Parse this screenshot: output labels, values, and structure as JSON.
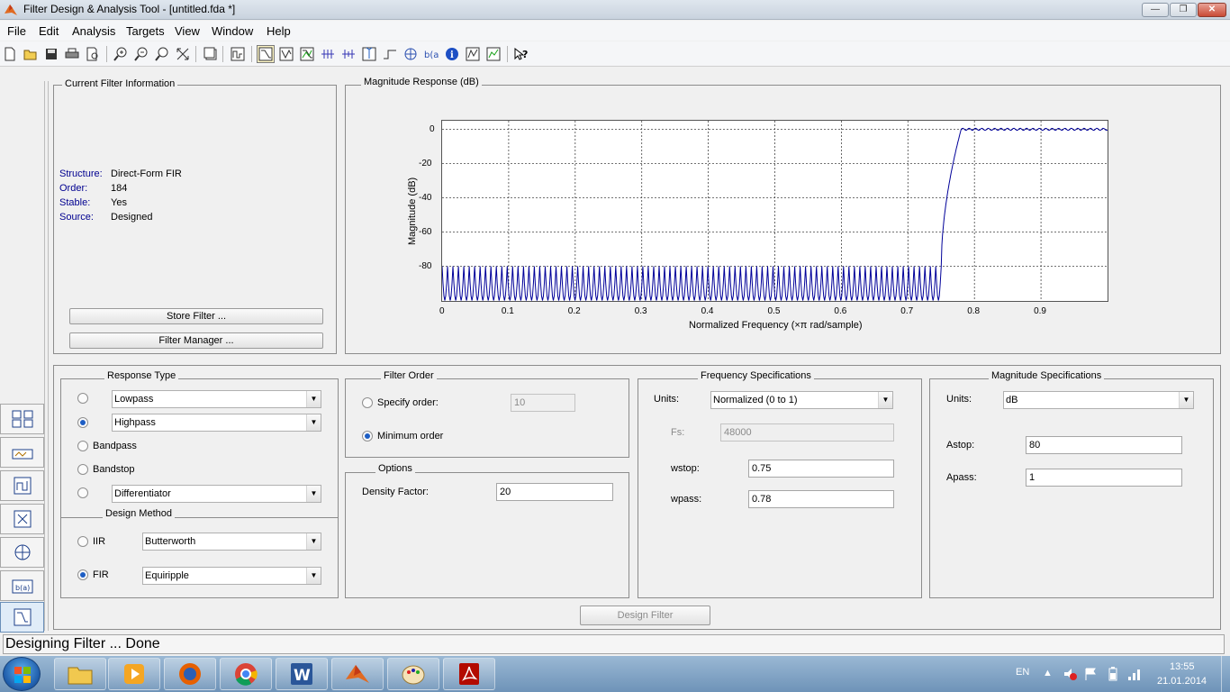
{
  "window": {
    "title": "Filter Design & Analysis Tool -  [untitled.fda *]",
    "controls": {
      "minimize": "—",
      "maximize": "❐",
      "close": "✕"
    }
  },
  "menu": [
    "File",
    "Edit",
    "Analysis",
    "Targets",
    "View",
    "Window",
    "Help"
  ],
  "toolbar": {
    "icons": [
      "new-file-icon",
      "open-folder-icon",
      "save-icon",
      "print-icon",
      "print-preview-icon",
      "zoom-in-icon",
      "zoom-out-icon",
      "zoom-x-icon",
      "full-view-icon",
      "new-figure-icon",
      "filter-spec-icon",
      "magnitude-response-icon",
      "phase-response-icon",
      "mag-phase-icon",
      "group-delay-icon",
      "phase-delay-icon",
      "impulse-response-icon",
      "step-response-icon",
      "pole-zero-icon",
      "coefficients-icon",
      "filter-info-icon",
      "round-off-noise-icon",
      "magnitude-estimate-icon",
      "whats-this-icon"
    ]
  },
  "sidebar": {
    "icons": [
      "transform-filter-icon",
      "create-multirate-icon",
      "realize-model-icon",
      "import-filter-icon",
      "pole-zero-editor-icon",
      "export-filter-icon",
      "design-filter-icon"
    ]
  },
  "current_filter": {
    "title": "Current Filter Information",
    "rows": [
      {
        "label": "Structure:",
        "value": "Direct-Form FIR"
      },
      {
        "label": "Order:",
        "value": "184"
      },
      {
        "label": "Stable:",
        "value": "Yes"
      },
      {
        "label": "Source:",
        "value": "Designed"
      }
    ],
    "store_button": "Store Filter ...",
    "manager_button": "Filter Manager ..."
  },
  "magnitude_response": {
    "title": "Magnitude Response (dB)",
    "chart_data": {
      "type": "line",
      "xlabel": "Normalized Frequency (×π rad/sample)",
      "ylabel": "Magnitude (dB)",
      "xlim": [
        0,
        1
      ],
      "ylim": [
        -100,
        5
      ],
      "x_ticks": [
        "0",
        "0.1",
        "0.2",
        "0.3",
        "0.4",
        "0.5",
        "0.6",
        "0.7",
        "0.8",
        "0.9"
      ],
      "y_ticks": [
        "0",
        "-20",
        "-40",
        "-60",
        "-80"
      ],
      "grid": true,
      "color": "#000099",
      "stopband_edge": 0.75,
      "passband_edge": 0.78,
      "stopband_peak_db": -80,
      "stopband_floor_db": -100,
      "passband_db": 0,
      "stopband_lobes": 92
    }
  },
  "response_type": {
    "title": "Response Type",
    "options": [
      {
        "label": "Lowpass",
        "selected": false,
        "combo": true
      },
      {
        "label": "Highpass",
        "selected": true,
        "combo": true
      },
      {
        "label": "Bandpass",
        "selected": false,
        "combo": false
      },
      {
        "label": "Bandstop",
        "selected": false,
        "combo": false
      },
      {
        "label": "Differentiator",
        "selected": false,
        "combo": true
      }
    ]
  },
  "design_method": {
    "title": "Design Method",
    "iir_label": "IIR",
    "iir_value": "Butterworth",
    "fir_label": "FIR",
    "fir_value": "Equiripple",
    "selected": "FIR"
  },
  "filter_order": {
    "title": "Filter Order",
    "specify_label": "Specify order:",
    "specify_value": "10",
    "minimum_label": "Minimum order",
    "selected": "Minimum order"
  },
  "options": {
    "title": "Options",
    "density_label": "Density Factor:",
    "density_value": "20"
  },
  "frequency_specs": {
    "title": "Frequency Specifications",
    "units_label": "Units:",
    "units_value": "Normalized (0 to 1)",
    "fs_label": "Fs:",
    "fs_value": "48000",
    "wstop_label": "wstop:",
    "wstop_value": "0.75",
    "wpass_label": "wpass:",
    "wpass_value": "0.78"
  },
  "magnitude_specs": {
    "title": "Magnitude Specifications",
    "units_label": "Units:",
    "units_value": "dB",
    "astop_label": "Astop:",
    "astop_value": "80",
    "apass_label": "Apass:",
    "apass_value": "1"
  },
  "design_button": "Design Filter",
  "status": "Designing Filter ... Done",
  "taskbar": {
    "apps": [
      "explorer-icon",
      "media-player-icon",
      "firefox-icon",
      "chrome-icon",
      "word-icon",
      "matlab-icon",
      "paint-icon",
      "acrobat-icon"
    ],
    "language": "EN",
    "time": "13:55",
    "date": "21.01.2014"
  }
}
